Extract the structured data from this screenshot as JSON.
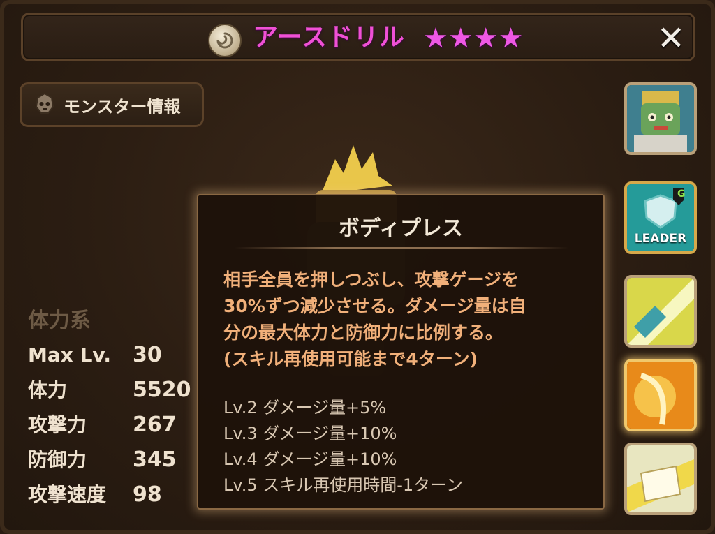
{
  "header": {
    "title": "アースドリル",
    "stars": [
      "★",
      "★",
      "★",
      "★"
    ],
    "star_color": "#ee58e4",
    "title_color": "#f050d6",
    "element_icon": "wind-element-icon",
    "close_label": "✕"
  },
  "info_tab": {
    "icon": "monster-head-icon",
    "label": "モンスター情報"
  },
  "stats": {
    "category": "体力系",
    "rows": [
      {
        "key": "Max Lv.",
        "value": "30"
      },
      {
        "key": "体力",
        "value": "5520"
      },
      {
        "key": "攻撃力",
        "value": "267"
      },
      {
        "key": "防御力",
        "value": "345"
      },
      {
        "key": "攻撃速度",
        "value": "98"
      }
    ]
  },
  "tooltip": {
    "title": "ボディプレス",
    "desc": [
      "相手全員を押しつぶし、攻撃ゲージを",
      "30%ずつ減少させる。ダメージ量は自",
      "分の最大体力と防御力に比例する。",
      "(スキル再使用可能まで4ターン)"
    ],
    "levels": [
      "Lv.2 ダメージ量+5%",
      "Lv.3 ダメージ量+10%",
      "Lv.4 ダメージ量+10%",
      "Lv.5 スキル再使用時間-1ターン"
    ]
  },
  "skills": {
    "portrait_icon": "monster-portrait-icon",
    "leader_label": "LEADER",
    "leader_badge": "G",
    "skill_icons": [
      "skill-1-icon",
      "skill-2-icon",
      "skill-3-icon"
    ],
    "selected_index": 1
  }
}
